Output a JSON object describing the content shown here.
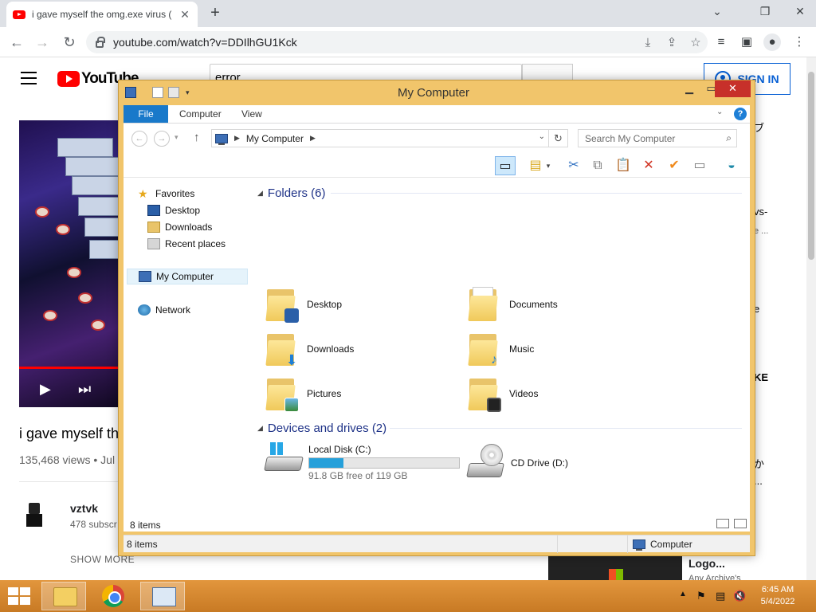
{
  "browser": {
    "tab_title": "i gave myself the omg.exe virus (",
    "tab_close": "✕",
    "new_tab": "+",
    "url": "youtube.com/watch?v=DDIlhGU1Kck",
    "window_controls": {
      "collapse": "⌄",
      "restore": "❐",
      "close": "✕"
    }
  },
  "youtube": {
    "logo": "YouTube",
    "search_value": "error",
    "sign_in": "SIGN IN",
    "video_title": "i gave myself th",
    "views": "135,468 views • Jul",
    "channel_name": "vztvk",
    "subscribers": "478 subscr",
    "show_more": "SHOW MORE",
    "right_snippets": [
      {
        "text": "ブ"
      },
      {
        "text": "vs-"
      },
      {
        "text": "e ..."
      },
      {
        "text": "e"
      },
      {
        "text": "KE"
      },
      {
        "text": "か"
      },
      {
        "text": "..."
      }
    ],
    "right_title": "Logo...",
    "right_sub": "Any Archive's"
  },
  "explorer": {
    "title": "My Computer",
    "ribbon_tabs": [
      "File",
      "Computer",
      "View"
    ],
    "help": "?",
    "address_location": "My Computer",
    "search_placeholder": "Search My Computer",
    "nav": {
      "favorites": "Favorites",
      "desktop": "Desktop",
      "downloads": "Downloads",
      "recent": "Recent places",
      "my_computer": "My Computer",
      "network": "Network"
    },
    "folders_header": "Folders (6)",
    "folders": [
      {
        "name": "Desktop",
        "emblem": "desktop"
      },
      {
        "name": "Documents",
        "emblem": "documents"
      },
      {
        "name": "Downloads",
        "emblem": "downloads"
      },
      {
        "name": "Music",
        "emblem": "music"
      },
      {
        "name": "Pictures",
        "emblem": "pictures"
      },
      {
        "name": "Videos",
        "emblem": "videos"
      }
    ],
    "drives_header": "Devices and drives (2)",
    "drives": [
      {
        "name": "Local Disk (C:)",
        "free": "91.8 GB free of 119 GB",
        "used_fraction": 0.23
      },
      {
        "name": "CD Drive (D:)"
      }
    ],
    "item_count": "8 items",
    "status_count": "8 items",
    "status_location": "Computer"
  },
  "taskbar": {
    "time": "6:45 AM",
    "date": "5/4/2022"
  },
  "colors": {
    "window_frame": "#f1c56b",
    "taskbar": "#d98a30",
    "accent_blue": "#1979ca",
    "close_red": "#c7302a",
    "usage_bar": "#26a0da"
  }
}
